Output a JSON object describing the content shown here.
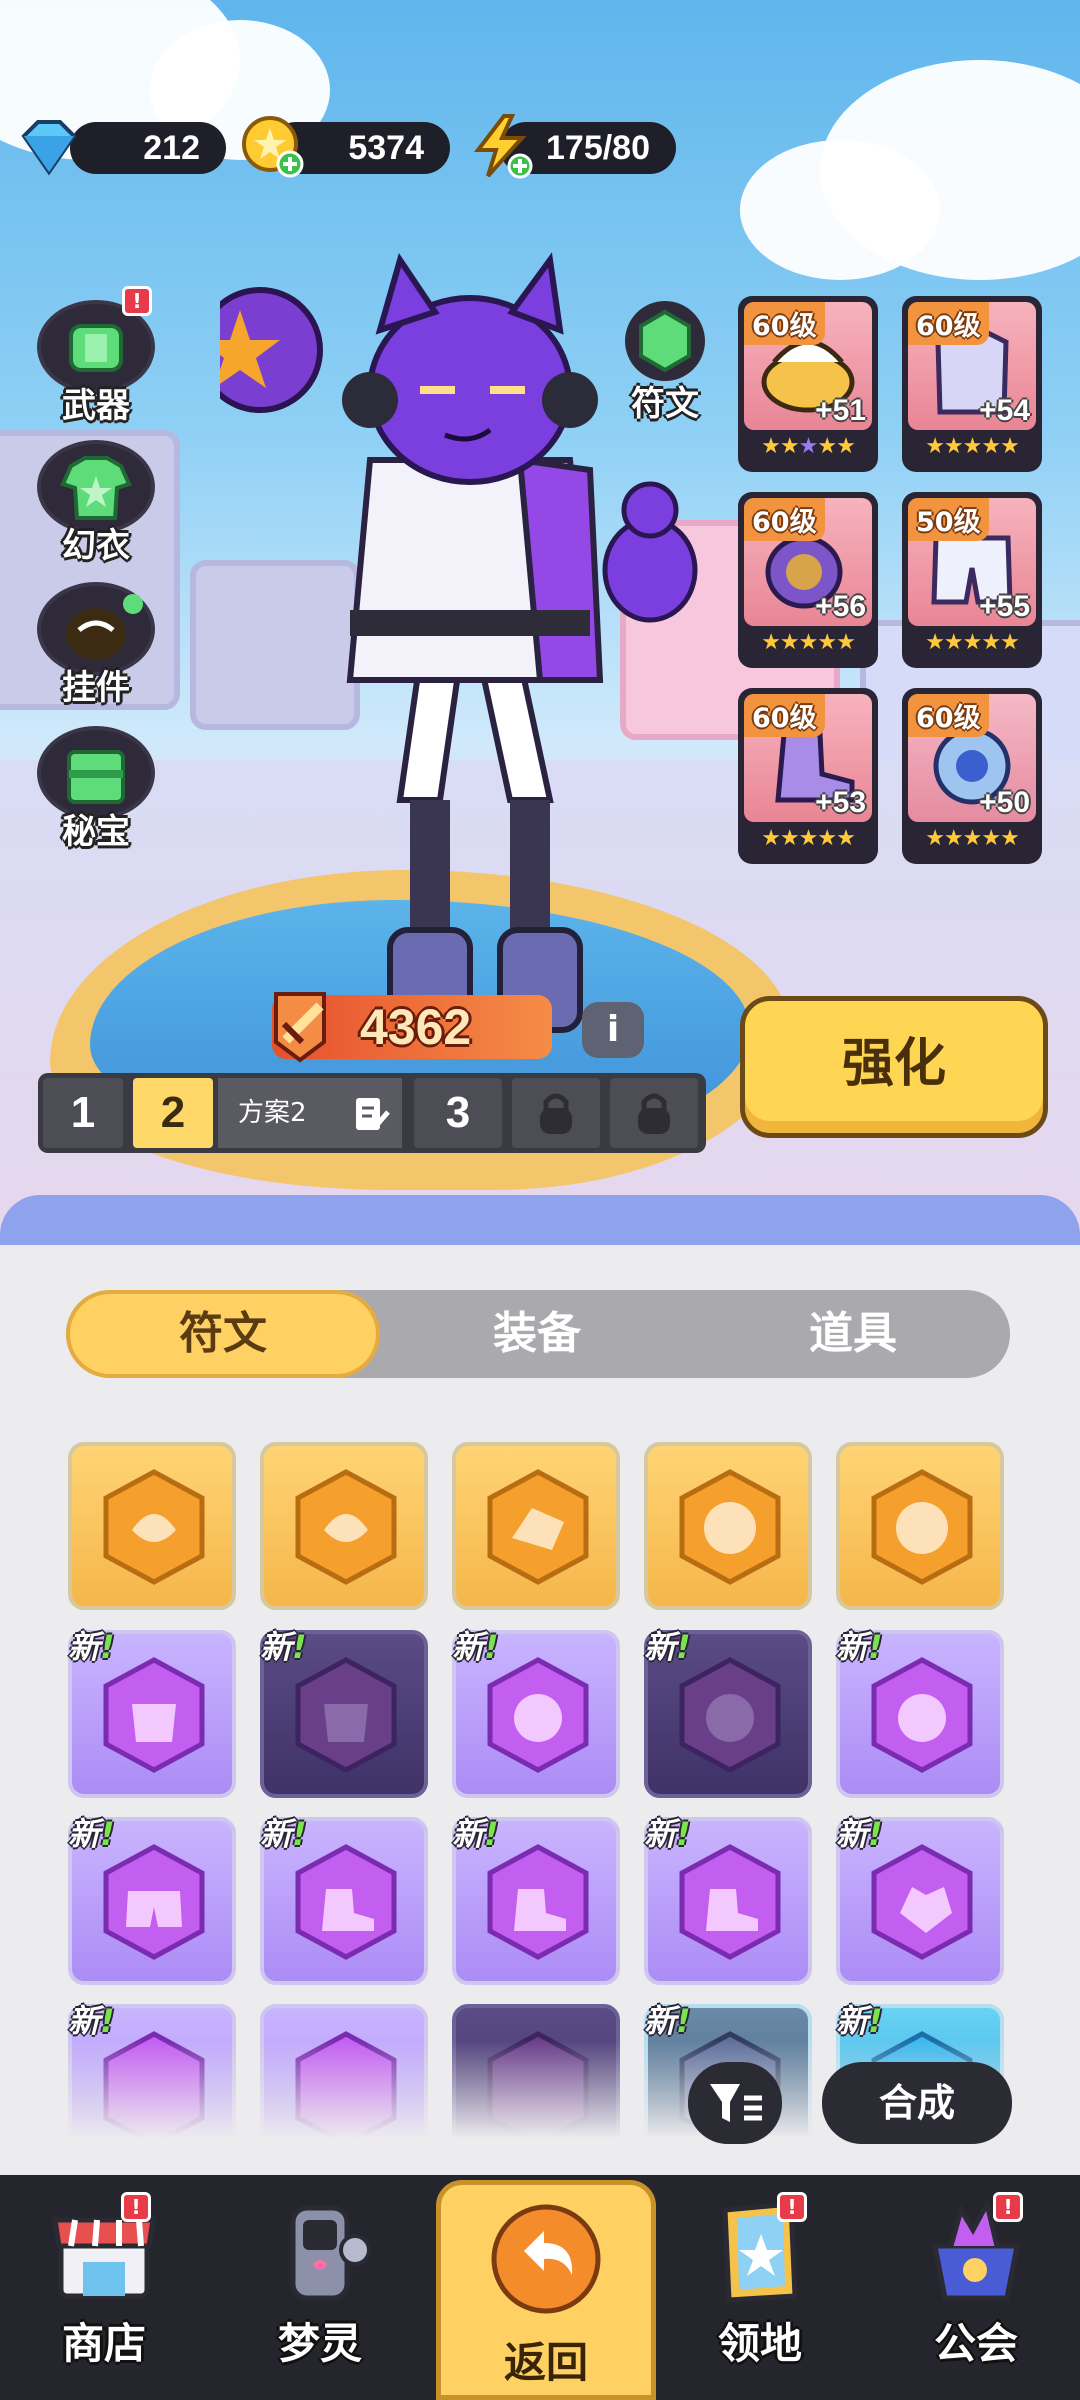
{
  "resources": {
    "gems": "212",
    "coins": "5374",
    "energy": "175/80"
  },
  "side_menu": {
    "weapon": "武器",
    "outfit": "幻衣",
    "pendant": "挂件",
    "treasure": "秘宝",
    "badge": "!"
  },
  "rune_button": "符文",
  "gear": [
    {
      "level": "60级",
      "plus": "+51",
      "stars": "★★★★★"
    },
    {
      "level": "60级",
      "plus": "+54",
      "stars": "★★★★★"
    },
    {
      "level": "60级",
      "plus": "+56",
      "stars": "★★★★★"
    },
    {
      "level": "50级",
      "plus": "+55",
      "stars": "★★★★★"
    },
    {
      "level": "60级",
      "plus": "+53",
      "stars": "★★★★★"
    },
    {
      "level": "60级",
      "plus": "+50",
      "stars": "★★★★★"
    }
  ],
  "power": "4362",
  "info": "i",
  "enhance": "强化",
  "plans": {
    "p1": "1",
    "p2": "2",
    "p2_name": "方案2",
    "p3": "3"
  },
  "tabs": {
    "runes": "符文",
    "equipment": "装备",
    "items": "道具"
  },
  "new_label": "新",
  "new_bang": "!",
  "compose": "合成",
  "nav": {
    "shop": "商店",
    "dream_spirit": "梦灵",
    "back": "返回",
    "territory": "领地",
    "guild": "公会",
    "badge": "!"
  },
  "colors": {
    "accent_gold": "#ffd162",
    "rune_purple": "#ab8cf5",
    "dark_ui": "#25252d"
  }
}
